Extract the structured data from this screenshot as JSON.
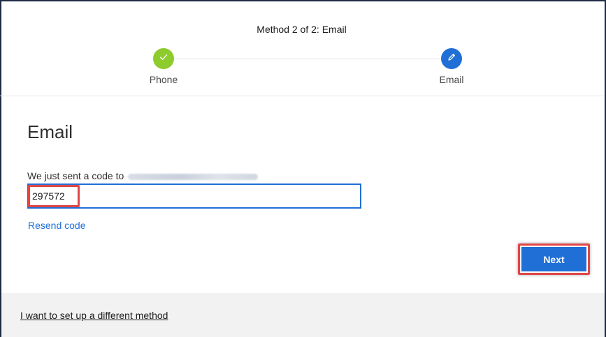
{
  "header": {
    "title": "Method 2 of 2: Email",
    "steps": [
      {
        "label": "Phone",
        "icon": "check-icon",
        "status": "complete",
        "color": "#8ecb2d"
      },
      {
        "label": "Email",
        "icon": "pencil-icon",
        "status": "current",
        "color": "#1f6fd6"
      }
    ]
  },
  "main": {
    "heading": "Email",
    "instruction": "We just sent a code to",
    "code_value": "297572",
    "resend_label": "Resend code",
    "next_label": "Next"
  },
  "footer": {
    "alt_method_label": "I want to set up a different method"
  },
  "colors": {
    "accent": "#1f6fd6",
    "success": "#8ecb2d",
    "highlight": "#e04646"
  }
}
